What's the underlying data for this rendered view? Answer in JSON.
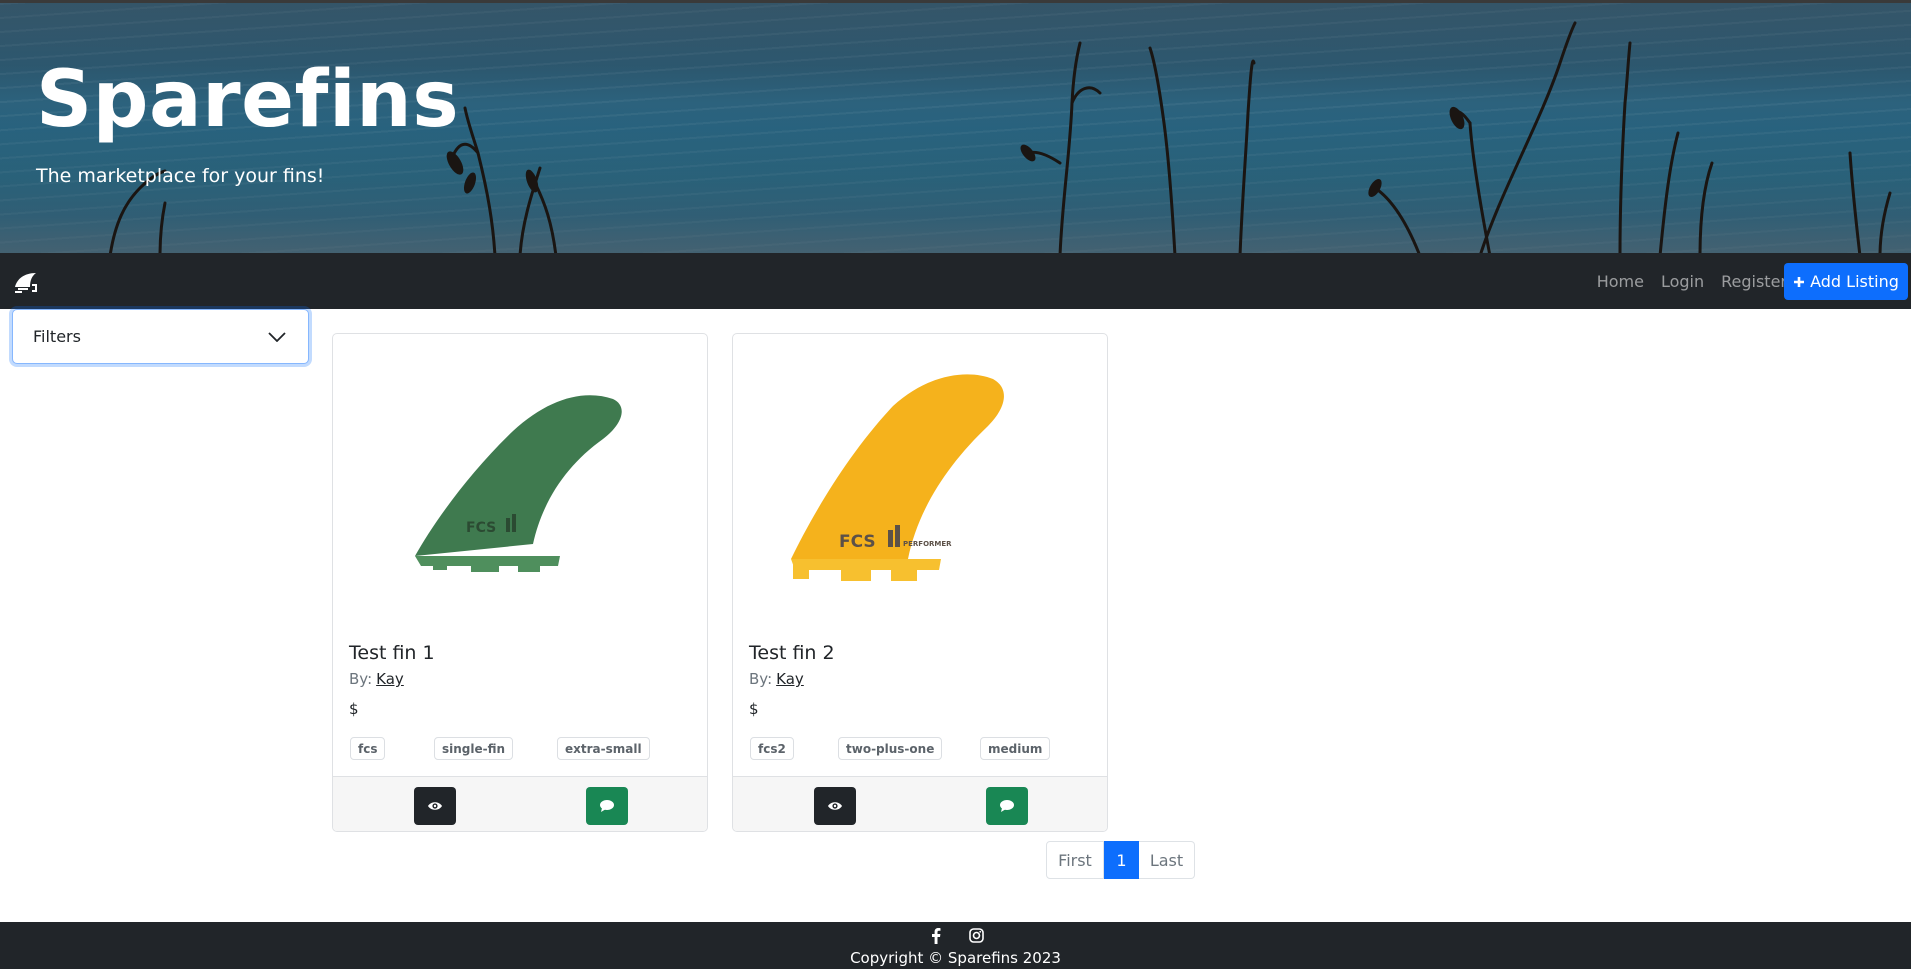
{
  "hero": {
    "title": "Sparefins",
    "subtitle": "The marketplace for your fins!"
  },
  "navbar": {
    "logo_icon": "fin-logo-icon",
    "links": [
      "Home",
      "Login",
      "Register"
    ],
    "add_listing_label": "Add Listing",
    "add_listing_icon": "plus-icon",
    "accent_color": "#0d6efd"
  },
  "filters": {
    "label": "Filters",
    "icon": "chevron-down-icon"
  },
  "listings": [
    {
      "title": "Test fin 1",
      "by_label": "By:",
      "author": "Kay",
      "price": "$",
      "tags": [
        "fcs",
        "single-fin",
        "extra-small"
      ],
      "image_color": "#3f7a4f",
      "view_icon": "eye-icon",
      "message_icon": "comment-icon"
    },
    {
      "title": "Test fin 2",
      "by_label": "By:",
      "author": "Kay",
      "price": "$",
      "tags": [
        "fcs2",
        "two-plus-one",
        "medium"
      ],
      "image_color": "#f5b21c",
      "view_icon": "eye-icon",
      "message_icon": "comment-icon"
    }
  ],
  "pagination": {
    "first": "First",
    "current": "1",
    "last": "Last"
  },
  "footer": {
    "social_icons": [
      "facebook-icon",
      "instagram-icon"
    ],
    "copyright": "Copyright © Sparefins 2023"
  }
}
